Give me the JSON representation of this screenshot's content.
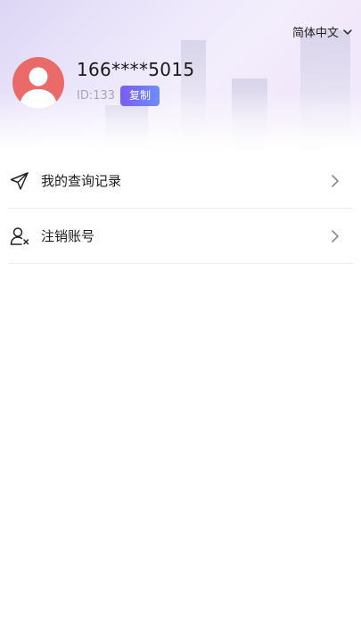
{
  "header": {
    "language": "简体中文",
    "phone": "166****5015",
    "id_text": "ID:133",
    "copy_label": "复制"
  },
  "menu": {
    "items": [
      {
        "label": "我的查询记录",
        "icon": "paper-plane-icon"
      },
      {
        "label": "注销账号",
        "icon": "user-remove-icon"
      }
    ]
  },
  "colors": {
    "avatar_bg": "#ea6a6a",
    "copy_gradient_start": "#7a5cf6",
    "copy_gradient_end": "#6c8df8",
    "id_text": "#a6a6b2"
  }
}
